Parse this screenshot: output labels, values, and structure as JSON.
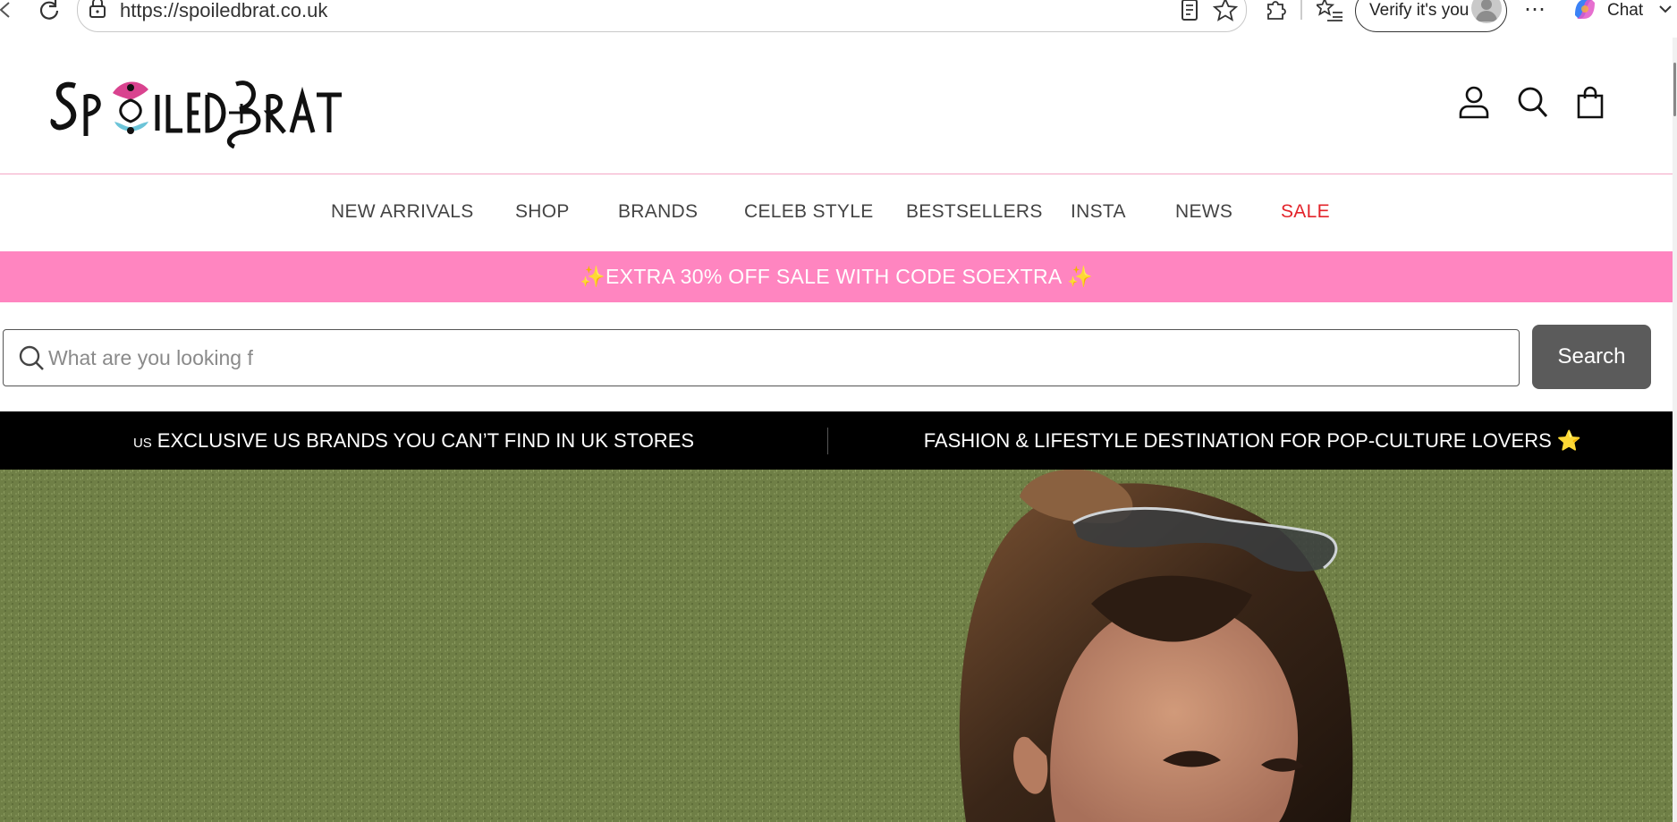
{
  "browser": {
    "url": "https://spoiledbrat.co.uk",
    "verify_label": "Verify it's you",
    "chat_label": "Chat",
    "icons": [
      "back-icon",
      "refresh-icon",
      "lock-icon",
      "reader-view-icon",
      "favorite-star-icon",
      "extensions-icon",
      "favorites-list-icon",
      "profile-avatar-icon",
      "more-icon",
      "copilot-icon"
    ]
  },
  "header": {
    "logo_text": "SPOILEDBRAT",
    "icons": [
      "account-icon",
      "search-icon",
      "cart-icon"
    ]
  },
  "nav": {
    "items": [
      {
        "label": "NEW ARRIVALS"
      },
      {
        "label": "SHOP"
      },
      {
        "label": "BRANDS"
      },
      {
        "label": "CELEB STYLE"
      },
      {
        "label": "BESTSELLERS"
      },
      {
        "label": "INSTA"
      },
      {
        "label": "NEWS"
      },
      {
        "label": "SALE"
      }
    ],
    "sale_color": "#e3242b"
  },
  "promo": {
    "text": "✨EXTRA 30% OFF SALE WITH CODE SOEXTRA ✨",
    "background": "#ff85c0"
  },
  "search": {
    "placeholder": "What are you looking f",
    "value": "",
    "button_label": "Search"
  },
  "announcement": {
    "left_flag": "US",
    "left_text": "EXCLUSIVE US BRANDS YOU CAN’T FIND IN UK STORES",
    "right_text": "FASHION & LIFESTYLE DESTINATION FOR POP-CULTURE LOVERS ⭐"
  },
  "hero": {
    "image": "woman-with-sunglasses-on-grass-photo"
  },
  "colors": {
    "accent_pink": "#ff85c0",
    "header_border": "#f4a6c6",
    "search_button": "#5b5b5b",
    "announcement_bg": "#000000"
  }
}
